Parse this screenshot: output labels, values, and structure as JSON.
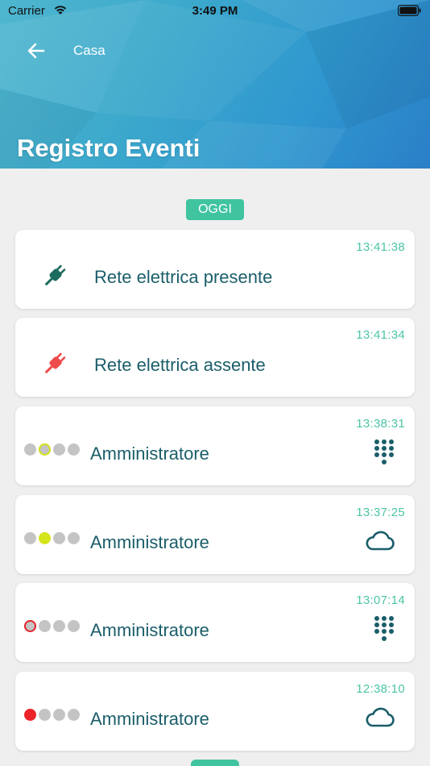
{
  "status_bar": {
    "carrier": "Carrier",
    "time": "3:49 PM"
  },
  "header": {
    "breadcrumb": "Casa",
    "title": "Registro Eventi",
    "gradient_colors": [
      "#4fb6cf",
      "#2b7fc7"
    ]
  },
  "day_label": "OGGI",
  "colors": {
    "accent_green": "#40c4a0",
    "text_teal": "#1b5e6a",
    "plug_ok": "#1b6b5e",
    "plug_alert": "#ef4b4b",
    "dot_gray": "#c4c4c4",
    "dot_yellow": "#d4e51c",
    "dot_red": "#ec2328"
  },
  "events": [
    {
      "time": "13:41:38",
      "label": "Rete elettrica presente",
      "icon": "plug-icon",
      "status": "ok"
    },
    {
      "time": "13:41:34",
      "label": "Rete elettrica assente",
      "icon": "plug-icon",
      "status": "alert"
    },
    {
      "time": "13:38:31",
      "label": "Amministratore",
      "icon": "keypad-icon",
      "dots": [
        "gray",
        "yellow-ring",
        "gray",
        "gray"
      ]
    },
    {
      "time": "13:37:25",
      "label": "Amministratore",
      "icon": "cloud-icon",
      "dots": [
        "gray",
        "yellow",
        "gray",
        "gray"
      ]
    },
    {
      "time": "13:07:14",
      "label": "Amministratore",
      "icon": "keypad-icon",
      "dots": [
        "red-ring",
        "gray",
        "gray",
        "gray"
      ]
    },
    {
      "time": "12:38:10",
      "label": "Amministratore",
      "icon": "cloud-icon",
      "dots": [
        "red",
        "gray",
        "gray",
        "gray"
      ]
    }
  ]
}
